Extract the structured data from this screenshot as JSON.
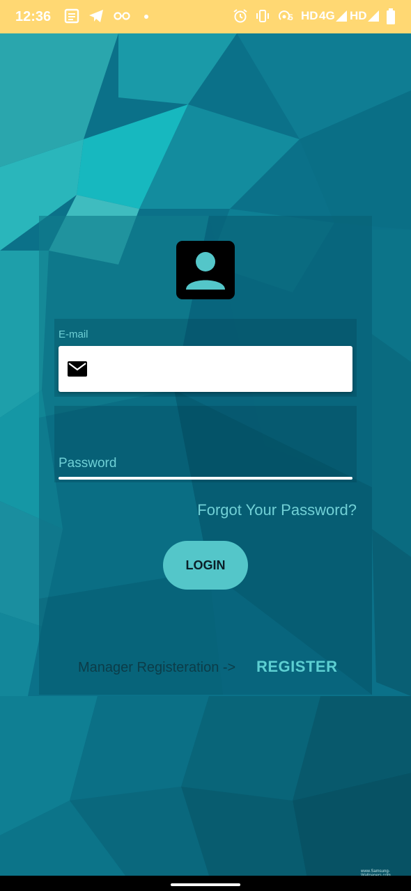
{
  "status_bar": {
    "time": "12:36",
    "signal_text_1": "HD",
    "signal_text_2": "4G",
    "signal_text_3": "HD",
    "hotspot_count": "5",
    "background_color": "#ffd873",
    "left_icons": [
      "document-icon",
      "telegram-icon",
      "glasses-icon",
      "dot-icon"
    ],
    "right_icons": [
      "alarm-icon",
      "vibrate-icon",
      "hotspot-icon",
      "signal-icon",
      "signal-icon",
      "battery-icon"
    ]
  },
  "login_form": {
    "email_label": "E-mail",
    "email_value": "",
    "email_icon": "mail-icon",
    "password_label": "Password",
    "password_value": "",
    "forgot_password": "Forgot Your Password?",
    "login_button": "LOGIN",
    "avatar_icon": "account-box-icon"
  },
  "footer": {
    "manager_text": "Manager Registeration ->",
    "register_link": "REGISTER"
  },
  "watermark": "www.Samsung-Wallpapers.com",
  "colors": {
    "accent": "#54c6c9",
    "link": "#71d0d6",
    "background": "#0a6f85"
  }
}
